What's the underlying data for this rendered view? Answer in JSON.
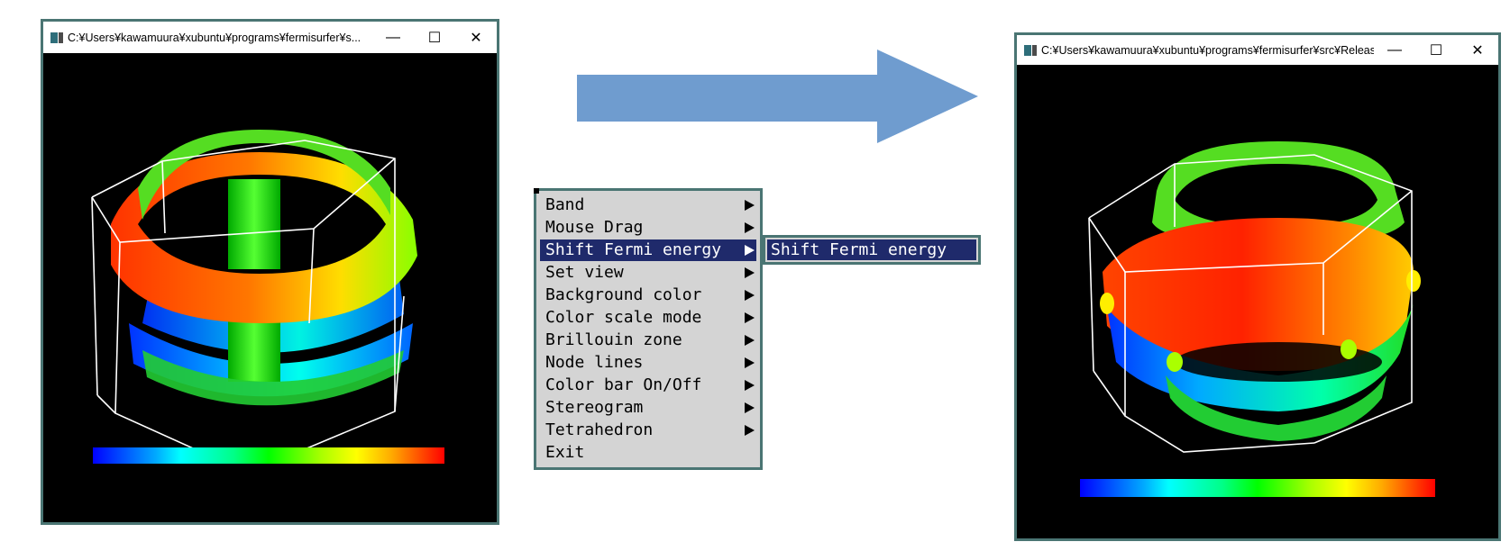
{
  "left_window": {
    "title": "C:¥Users¥kawamuura¥xubuntu¥programs¥fermisurfer¥s...",
    "minimize": "—",
    "maximize": "☐",
    "close": "✕"
  },
  "right_window": {
    "title": "C:¥Users¥kawamuura¥xubuntu¥programs¥fermisurfer¥src¥Release¥ferm...",
    "minimize": "—",
    "maximize": "☐",
    "close": "✕"
  },
  "menu": {
    "items": [
      {
        "label": "Band",
        "submenu": true
      },
      {
        "label": "Mouse Drag",
        "submenu": true
      },
      {
        "label": "Shift Fermi energy",
        "submenu": true,
        "selected": true
      },
      {
        "label": "Set view",
        "submenu": true
      },
      {
        "label": "Background color",
        "submenu": true
      },
      {
        "label": "Color scale mode",
        "submenu": true
      },
      {
        "label": "Brillouin zone",
        "submenu": true
      },
      {
        "label": "Node lines",
        "submenu": true
      },
      {
        "label": "Color bar On/Off",
        "submenu": true
      },
      {
        "label": "Stereogram",
        "submenu": true
      },
      {
        "label": "Tetrahedron",
        "submenu": true
      },
      {
        "label": "Exit",
        "submenu": false
      }
    ]
  },
  "submenu": {
    "items": [
      {
        "label": "Shift Fermi energy"
      }
    ]
  },
  "colors": {
    "menu_bg": "#d4d4d4",
    "menu_highlight": "#1f2a6b",
    "window_border": "#4a7573",
    "arrow": "#6f9ccf"
  }
}
